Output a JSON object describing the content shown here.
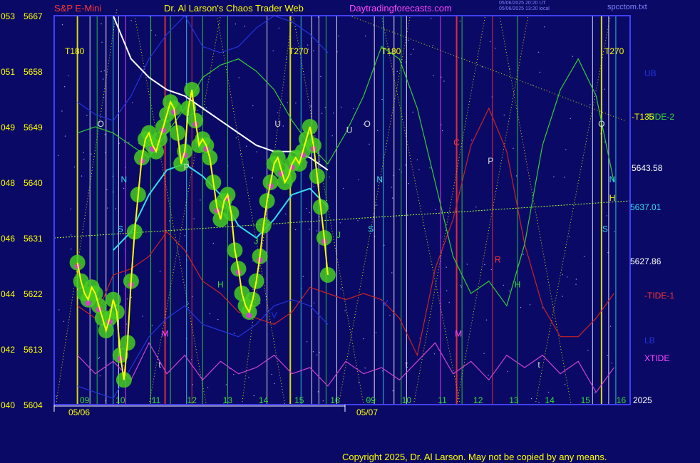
{
  "header": {
    "instrument": "S&P E-Mini",
    "site_title": "Dr. Al Larson's Chaos Trader Web",
    "site_url": "Daytradingforecasts.com",
    "stamp_ut": "05/06/2025 20:20 UT",
    "stamp_local": "05/06/2025 13:20 local",
    "file": "spcctom.txt"
  },
  "footer": {
    "copyright": "Copyright 2025, Dr. Al Larson. May not be copied by any means."
  },
  "colors": {
    "background": "#0a0a66",
    "plot_border": "#4040ff",
    "price": "#ffff00",
    "price_glow": "#44cc22",
    "short_avg": "#ffffff",
    "mid_avg": "#33ddee",
    "tide2": "#33cc33",
    "tide1": "#cc2222",
    "xtide": "#cc44cc",
    "bands": "#2233dd",
    "title_red": "#ff3333",
    "title_yellow": "#ffff00",
    "title_magenta": "#ff44ff"
  },
  "chart_data": {
    "type": "line",
    "y_axis": {
      "range": [
        5604,
        5667
      ],
      "tick_labels": [
        {
          "code": "053",
          "price": "5667"
        },
        {
          "code": "051",
          "price": "5658"
        },
        {
          "code": "049",
          "price": "5649"
        },
        {
          "code": "048",
          "price": "5640"
        },
        {
          "code": "046",
          "price": "5631"
        },
        {
          "code": "044",
          "price": "5622"
        },
        {
          "code": "042",
          "price": "5613"
        },
        {
          "code": "040",
          "price": "5604"
        }
      ]
    },
    "x_axis": {
      "hour_labels": [
        "09",
        "10",
        "11",
        "12",
        "13",
        "14",
        "15",
        "16",
        "09",
        "10",
        "11",
        "12",
        "13",
        "14",
        "15",
        "16"
      ],
      "date_labels": [
        "05/06",
        "05/07"
      ]
    },
    "cycle_labels": [
      "T180",
      "T270",
      "T180",
      "T270"
    ],
    "level_labels": {
      "upper_level": "5643.58",
      "mid_level": "5637.01",
      "lower_level": "5627.86",
      "t135": "-T135",
      "year": "2025"
    },
    "series": [
      {
        "name": "UB"
      },
      {
        "name": "-TIDE-2"
      },
      {
        "name": "-TIDE-1"
      },
      {
        "name": "LB"
      },
      {
        "name": "XTIDE"
      }
    ],
    "planet_letters": [
      "O",
      "N",
      "S",
      "M",
      "t",
      "P",
      "H",
      "U",
      "J",
      "V",
      "O",
      "N",
      "S",
      "U",
      "J",
      "V",
      "t",
      "C",
      "P",
      "R",
      "M",
      "H",
      "O",
      "N",
      "S",
      "H",
      "t"
    ],
    "price_series": {
      "x_hours": [
        9.0,
        9.1,
        9.2,
        9.3,
        9.4,
        9.5,
        9.6,
        9.7,
        9.8,
        9.9,
        10.0,
        10.1,
        10.2,
        10.3,
        10.4,
        10.5,
        10.6,
        10.7,
        10.8,
        10.9,
        11.0,
        11.1,
        11.2,
        11.3,
        11.4,
        11.5,
        11.6,
        11.7,
        11.8,
        11.9,
        12.0,
        12.1,
        12.2,
        12.3,
        12.4,
        12.5,
        12.6,
        12.7,
        12.8,
        12.9,
        13.0,
        13.1,
        13.2,
        13.3,
        13.4,
        13.5,
        13.6,
        13.7,
        13.8,
        13.9,
        14.0,
        14.1,
        14.2,
        14.3,
        14.4,
        14.5,
        14.6,
        14.7,
        14.8,
        14.9,
        15.0,
        15.1,
        15.2,
        15.3,
        15.4,
        15.5,
        15.6,
        15.7,
        15.8,
        15.9,
        16.0
      ],
      "close": [
        5627,
        5624,
        5622,
        5621,
        5623,
        5622,
        5620,
        5618,
        5616,
        5618,
        5621,
        5619,
        5612,
        5608,
        5614,
        5624,
        5632,
        5638,
        5644,
        5647,
        5648,
        5646,
        5645,
        5647,
        5649,
        5651,
        5653,
        5652,
        5648,
        5643,
        5645,
        5652,
        5655,
        5650,
        5646,
        5647,
        5646,
        5644,
        5640,
        5636,
        5634,
        5637,
        5638,
        5635,
        5629,
        5626,
        5622,
        5620,
        5619,
        5621,
        5624,
        5628,
        5633,
        5637,
        5640,
        5643,
        5644,
        5642,
        5640,
        5641,
        5643,
        5644,
        5643,
        5645,
        5647,
        5649,
        5646,
        5641,
        5636,
        5631,
        5625
      ]
    },
    "overlays": {
      "x_hours": [
        9.0,
        9.5,
        10.0,
        10.5,
        11.0,
        11.5,
        12.0,
        12.5,
        13.0,
        13.5,
        14.0,
        14.5,
        15.0,
        15.5,
        16.0,
        16.5,
        17.0,
        17.5,
        18.0,
        18.5,
        19.0,
        19.5,
        20.0,
        20.5,
        21.0,
        21.5,
        22.0,
        22.5,
        23.0,
        23.5,
        24.0
      ],
      "short_avg": [
        null,
        null,
        5667,
        5660,
        5657,
        5655,
        5654,
        5652,
        5650,
        5648,
        5646,
        5645,
        5645,
        5644,
        5642,
        null,
        null,
        null,
        null,
        null,
        null,
        null,
        null,
        null,
        null,
        null,
        null,
        null,
        null,
        null,
        null
      ],
      "mid_avg": [
        null,
        null,
        5629,
        5632,
        5638,
        5642,
        5643,
        5641,
        5638,
        5633,
        5631,
        5634,
        5638,
        5639,
        5636,
        null,
        null,
        null,
        null,
        null,
        null,
        null,
        null,
        null,
        null,
        null,
        null,
        null,
        null,
        null,
        null
      ],
      "tide2": [
        5648,
        5649,
        5648,
        5646,
        5644,
        5648,
        5652,
        5657,
        5659,
        5660,
        5658,
        5655,
        5650,
        5646,
        5643,
        5648,
        5654,
        5662,
        5660,
        5652,
        5640,
        5628,
        5622,
        5624,
        5620,
        5630,
        5646,
        5655,
        5660,
        5654,
        5640
      ],
      "tide1": [
        5620,
        5618,
        5625,
        5626,
        5628,
        5632,
        5629,
        5624,
        5622,
        5619,
        5618,
        5617,
        5619,
        5623,
        5622,
        5621,
        5622,
        5621,
        5618,
        5612,
        5626,
        5634,
        5646,
        5652,
        5645,
        5630,
        5620,
        5615,
        5615,
        5618,
        5622
      ],
      "xtide": [
        5612,
        5609,
        5611,
        5608,
        5614,
        5609,
        5612,
        5608,
        5611,
        5609,
        5610,
        5612,
        5609,
        5610,
        5607,
        5611,
        5609,
        5610,
        5608,
        5611,
        5614,
        5609,
        5611,
        5608,
        5612,
        5610,
        5612,
        5609,
        5611,
        5606,
        5610
      ],
      "upper_band": [
        5653,
        5651,
        5650,
        5654,
        5660,
        5664,
        5667,
        5662,
        5661,
        5662,
        5665,
        5667,
        5666,
        5664,
        5661,
        null,
        null,
        null,
        null,
        null,
        null,
        null,
        null,
        null,
        null,
        null,
        null,
        null,
        null,
        null,
        null
      ],
      "lower_band": [
        5607,
        5606,
        5605,
        5610,
        5615,
        5618,
        5620,
        5617,
        5616,
        5615,
        5617,
        5620,
        5621,
        5620,
        5617,
        null,
        null,
        null,
        null,
        null,
        null,
        null,
        null,
        null,
        null,
        null,
        null,
        null,
        null,
        null,
        null
      ],
      "dotted_level_start": 5631,
      "dotted_level_end": 5637
    }
  }
}
